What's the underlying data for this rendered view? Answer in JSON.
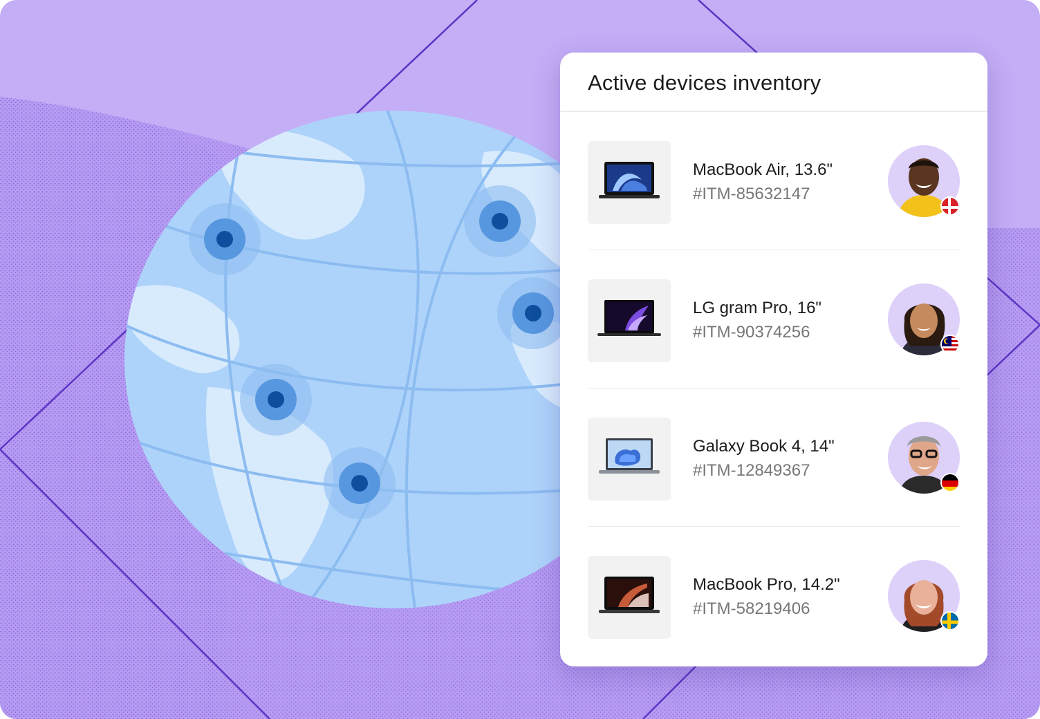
{
  "card": {
    "title": "Active devices inventory"
  },
  "devices": [
    {
      "name": "MacBook Air, 13.6\"",
      "id": "#ITM-85632147",
      "icon": "macbook-air-laptop-icon",
      "flag": "denmark-flag-icon"
    },
    {
      "name": "LG gram Pro, 16\"",
      "id": "#ITM-90374256",
      "icon": "lg-gram-laptop-icon",
      "flag": "malaysia-flag-icon"
    },
    {
      "name": "Galaxy Book 4, 14\"",
      "id": "#ITM-12849367",
      "icon": "galaxy-book-laptop-icon",
      "flag": "germany-flag-icon"
    },
    {
      "name": "MacBook Pro, 14.2\"",
      "id": "#ITM-58219406",
      "icon": "macbook-pro-laptop-icon",
      "flag": "sweden-flag-icon"
    }
  ],
  "colors": {
    "background": "#c4aef6",
    "globe": "#aed3fa",
    "marker": "#0d4f9c",
    "card": "#ffffff"
  }
}
